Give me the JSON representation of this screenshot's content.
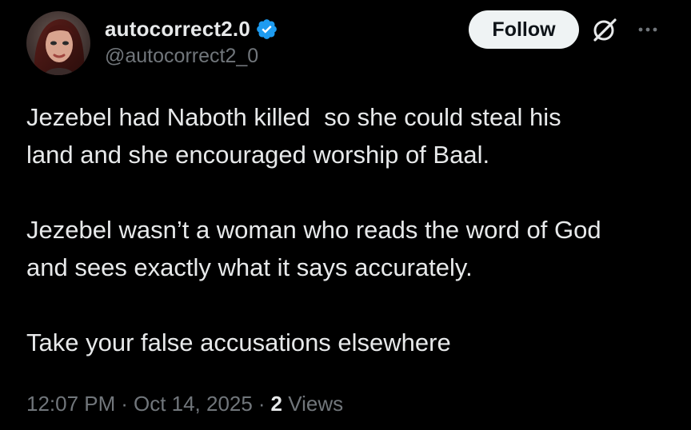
{
  "author": {
    "display_name": "autocorrect2.0",
    "handle": "@autocorrect2_0",
    "verified": true,
    "verified_color": "#1d9bf0"
  },
  "actions": {
    "follow_label": "Follow",
    "grok_icon": "grok-icon",
    "more_icon": "more-icon"
  },
  "tweet": {
    "paragraphs": [
      "Jezebel had Naboth killed  so she could steal his\nland and she encouraged worship of Baal.",
      "Jezebel wasn’t a woman who reads the word of God\nand sees exactly what it says accurately.",
      "Take your false accusations elsewhere"
    ]
  },
  "meta": {
    "time": "12:07 PM",
    "separator": "·",
    "date": "Oct 14, 2025",
    "views_count": "2",
    "views_label": "Views"
  },
  "colors": {
    "background": "#000000",
    "text_primary": "#e7e9ea",
    "text_secondary": "#71767b",
    "follow_bg": "#eff3f4"
  }
}
